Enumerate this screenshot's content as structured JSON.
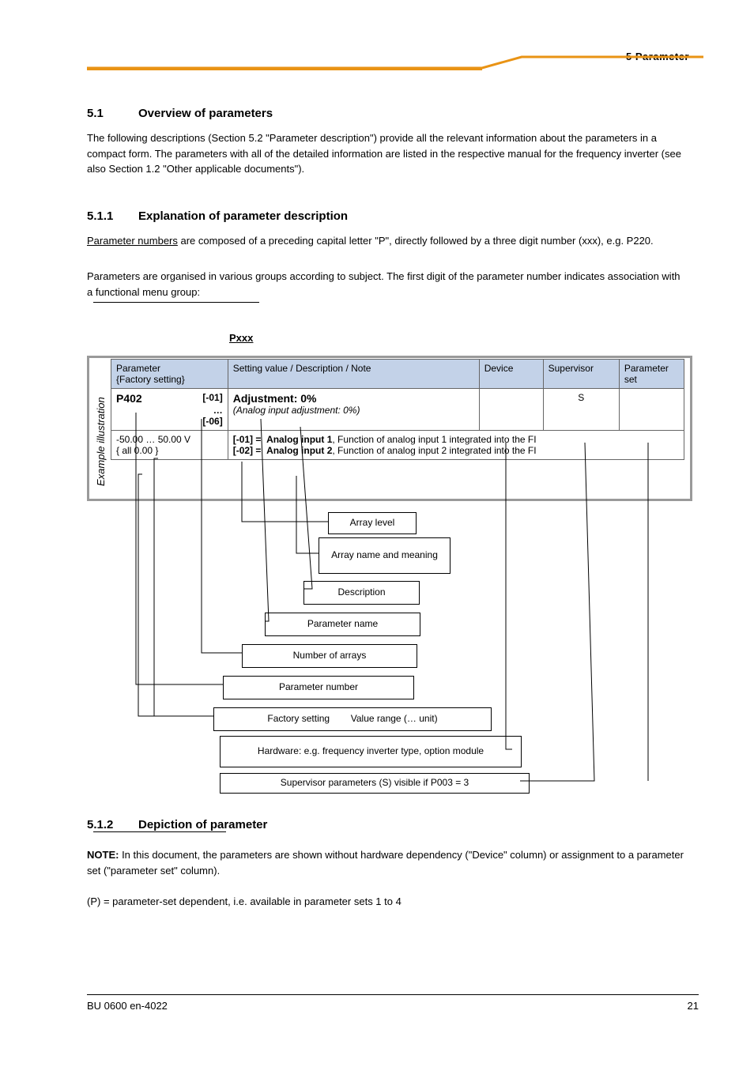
{
  "header": {
    "right_text": "5 Parameter"
  },
  "sections": {
    "s51": {
      "num": "5.1",
      "title": "Overview of parameters"
    },
    "s511": {
      "num": "5.1.1",
      "title": "Explanation of parameter description"
    },
    "s512": {
      "num": "5.1.2",
      "title": "Depiction of parameter"
    }
  },
  "paragraphs": {
    "p1": "The following descriptions (Section 5.2 \"Parameter description\") provide all the relevant information about the parameters in a compact form. The parameters with all of the detailed information are listed in the respective manual for the frequency inverter (see also Section 1.2 \"Other applicable documents\").",
    "p2_lead": "Parameter numbers",
    "p2_text": " are composed of a preceding capital letter \"P\", directly followed by a three digit number (xxx), e.g. P220.",
    "p3": "Parameters are organised in various groups according to subject. The first digit of the parameter number indicates association with a functional menu group:"
  },
  "table_header": {
    "c1_line1": "Parameter",
    "c1_line2": "{Factory setting}",
    "c2": "Setting value / Description / Note",
    "c3": "Device",
    "c4": "Supervisor",
    "c5_line1": "Parameter",
    "c5_line2": "set"
  },
  "example": {
    "rot_label": "Example illustration",
    "p_num": "P402",
    "arr1": "[-01]",
    "arr_dots": "…",
    "arr2": "[-06]",
    "adj_label": "Adjustment:  0%",
    "adj_sub": "(Analog input adjustment:  0%)",
    "sup": "S",
    "range": "-50.00 … 50.00 V",
    "fac": "{ all 0.00 }",
    "l1_key": "[-01] =",
    "l1_bold": "Analog input 1",
    "l1_rest": ",   Function of analog input 1 integrated into the FI",
    "l2_key": "[-02] =",
    "l2_bold": "Analog input 2",
    "l2_rest": ",   Function of analog input 2 integrated into the FI"
  },
  "callouts": {
    "c1": "Array level",
    "c2": "Array name and meaning",
    "c3": "Description",
    "c4": "Parameter name",
    "c5": "Number of arrays",
    "c6": "Parameter number",
    "c7": "Factory setting",
    "c8": "Value range (… unit)",
    "c9": "Hardware:  e.g. frequency inverter type,  option module",
    "c10_line1": "Supervisor parameters",
    "c10_line2": "(S) visible if P003 = 3",
    "c11_line1": "(P) = parameter-set dependent,",
    "c11_line2": "i.e. available in parameter sets 1 to 4"
  },
  "note": {
    "label": "NOTE:",
    "text": " In this document, the parameters are shown without hardware dependency (\"Device\" column) or assignment to a parameter set (\"parameter set\" column)."
  },
  "footer": {
    "left": "BU 0600 en-4022",
    "right": "21"
  }
}
